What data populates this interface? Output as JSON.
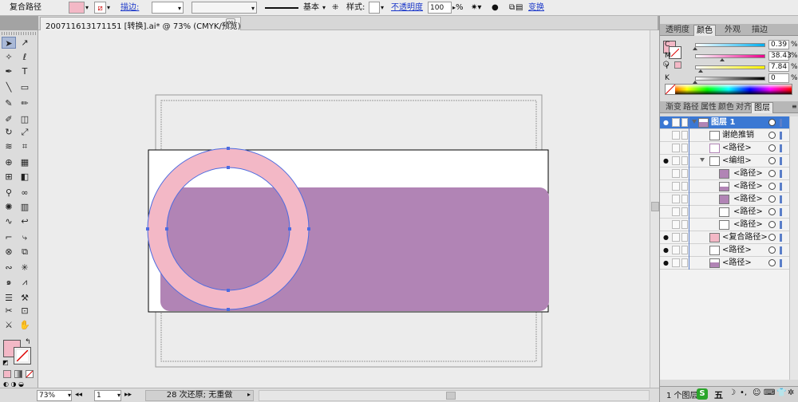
{
  "control_bar": {
    "object_type": "复合路径",
    "stroke_label": "描边:",
    "stroke_profile": "基本",
    "style_label": "样式:",
    "opacity_label": "不透明度",
    "opacity_value": "100",
    "opacity_unit": "%",
    "transform_label": "变换"
  },
  "document_tab": {
    "title": "200711613171151 [转换].ai* @ 73% (CMYK/预览)",
    "close": "×"
  },
  "tools": [
    {
      "name": "selection-tool-icon",
      "glyph": "➤"
    },
    {
      "name": "direct-selection-tool-icon",
      "glyph": "↗"
    },
    {
      "name": "magic-wand-tool-icon",
      "glyph": "✧"
    },
    {
      "name": "lasso-tool-icon",
      "glyph": "ℓ"
    },
    {
      "name": "pen-tool-icon",
      "glyph": "✒"
    },
    {
      "name": "type-tool-icon",
      "glyph": "T"
    },
    {
      "name": "line-tool-icon",
      "glyph": "╲"
    },
    {
      "name": "rectangle-tool-icon",
      "glyph": "▭"
    },
    {
      "name": "paintbrush-tool-icon",
      "glyph": "✎"
    },
    {
      "name": "pencil-tool-icon",
      "glyph": "✏"
    },
    {
      "name": "blob-brush-tool-icon",
      "glyph": "✐"
    },
    {
      "name": "eraser-tool-icon",
      "glyph": "◫"
    },
    {
      "name": "rotate-tool-icon",
      "glyph": "↻"
    },
    {
      "name": "scale-tool-icon",
      "glyph": "⤢"
    },
    {
      "name": "warp-tool-icon",
      "glyph": "≋"
    },
    {
      "name": "free-transform-tool-icon",
      "glyph": "⌗"
    },
    {
      "name": "shape-builder-tool-icon",
      "glyph": "⊕"
    },
    {
      "name": "perspective-grid-tool-icon",
      "glyph": "▦"
    },
    {
      "name": "mesh-tool-icon",
      "glyph": "⊞"
    },
    {
      "name": "gradient-tool-icon",
      "glyph": "◧"
    },
    {
      "name": "eyedropper-tool-icon",
      "glyph": "⚲"
    },
    {
      "name": "blend-tool-icon",
      "glyph": "∞"
    },
    {
      "name": "symbol-sprayer-tool-icon",
      "glyph": "✺"
    },
    {
      "name": "graph-tool-icon",
      "glyph": "▥"
    },
    {
      "name": "curvature-tool-icon",
      "glyph": "∿"
    },
    {
      "name": "join-tool-icon",
      "glyph": "↩"
    },
    {
      "name": "anchor-convert-tool-icon",
      "glyph": "⌐"
    },
    {
      "name": "anchor-delete-tool-icon",
      "glyph": "⤷"
    },
    {
      "name": "globe-tool-icon",
      "glyph": "⊗"
    },
    {
      "name": "envelope-tool-icon",
      "glyph": "⧉"
    },
    {
      "name": "wave-tool-icon",
      "glyph": "∾"
    },
    {
      "name": "crystallize-tool-icon",
      "glyph": "✳"
    },
    {
      "name": "twirl-tool-icon",
      "glyph": "๑"
    },
    {
      "name": "zigzag-tool-icon",
      "glyph": "⩘"
    },
    {
      "name": "column-graph-tool-icon",
      "glyph": "☰"
    },
    {
      "name": "slice-tool-icon",
      "glyph": "⚒"
    },
    {
      "name": "scissors-tool-icon",
      "glyph": "✂"
    },
    {
      "name": "artboard-tool-icon",
      "glyph": "⊡"
    },
    {
      "name": "knife-tool-icon",
      "glyph": "⚔"
    },
    {
      "name": "hand-tool-icon",
      "glyph": "✋"
    },
    {
      "name": "zoom-tool-icon",
      "glyph": "🔍"
    }
  ],
  "colors": {
    "fill": "#f3b8c6",
    "pink": "#f3b8c6",
    "purple": "#b184b5",
    "selection": "#4d6be0",
    "layer_color": "#5b7fc9"
  },
  "status_bar": {
    "zoom": "73%",
    "page": "1",
    "history": "28 次还原; 无重做"
  },
  "color_panel": {
    "tabs": [
      "透明度",
      "颜色",
      "外观",
      "描边"
    ],
    "channels": [
      {
        "label": "C",
        "value": "0.39",
        "pct": "%",
        "level": 0.39
      },
      {
        "label": "M",
        "value": "38.43",
        "pct": "%",
        "level": 38.43
      },
      {
        "label": "Y",
        "value": "7.84",
        "pct": "%",
        "level": 7.84
      },
      {
        "label": "K",
        "value": "0",
        "pct": "%",
        "level": 0
      }
    ]
  },
  "layers_panel": {
    "tabs": [
      "渐变",
      "路径",
      "属性",
      "颜色",
      "对齐",
      "图层"
    ],
    "rows": [
      {
        "name": "图层 1",
        "indent": 0,
        "toggle": true,
        "sel": true,
        "eye": true
      },
      {
        "name": "谢绝推销",
        "indent": 1,
        "toggle": false,
        "sel": false,
        "eye": false
      },
      {
        "name": "<路径>",
        "indent": 1,
        "toggle": false,
        "sel": false,
        "eye": false
      },
      {
        "name": "<编组>",
        "indent": 1,
        "toggle": true,
        "sel": false,
        "eye": true
      },
      {
        "name": "<路径>",
        "indent": 2,
        "toggle": false,
        "sel": false,
        "eye": false
      },
      {
        "name": "<路径>",
        "indent": 2,
        "toggle": false,
        "sel": false,
        "eye": false
      },
      {
        "name": "<路径>",
        "indent": 2,
        "toggle": false,
        "sel": false,
        "eye": false
      },
      {
        "name": "<路径>",
        "indent": 2,
        "toggle": false,
        "sel": false,
        "eye": false
      },
      {
        "name": "<路径>",
        "indent": 2,
        "toggle": false,
        "sel": false,
        "eye": false
      },
      {
        "name": "<复合路径>",
        "indent": 1,
        "toggle": false,
        "sel": false,
        "eye": true
      },
      {
        "name": "<路径>",
        "indent": 1,
        "toggle": false,
        "sel": false,
        "eye": true
      },
      {
        "name": "<路径>",
        "indent": 1,
        "toggle": false,
        "sel": false,
        "eye": true
      }
    ],
    "count_label": "1 个图层"
  },
  "taskbar": {
    "ime_label": "五"
  }
}
